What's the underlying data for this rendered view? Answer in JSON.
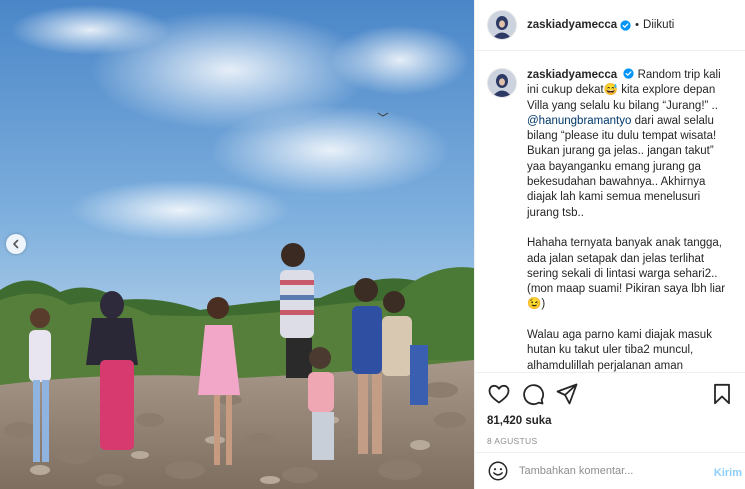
{
  "colors": {
    "verified": "#0095f6",
    "mention": "#00376b",
    "send": "#0095f6",
    "muted": "#8e8e8e"
  },
  "photo": {
    "prev_icon": "chevron-left-icon"
  },
  "header": {
    "username": "zaskiadyamecca",
    "separator": "•",
    "follow_label": "Diikuti",
    "verified_icon": "verified-badge-icon"
  },
  "caption": {
    "username": "zaskiadyamecca",
    "line_1": "Random trip kali ini cukup dekat😅 kita explore depan Villa yang selalu ku bilang “Jurang!” ..",
    "mention": "@hanungbramantyo",
    "line_1b": "dari awal selalu bilang “please itu dulu tempat wisata! Bukan jurang ga jelas.. jangan takut” yaa bayanganku emang jurang ga bekesudahan bawahnya.. Akhirnya diajak lah kami semua menelusuri jurang tsb..",
    "para_2": "Hahaha ternyata banyak anak tangga, ada jalan setapak dan jelas terlihat sering sekali di lintasi warga sehari2.. (mon maap suami! Pikiran saya lbh liar😉)",
    "para_3": "Walau aga parno kami diajak masuk hutan ku takut uler tiba2 muncul, alhamdulillah perjalanan aman"
  },
  "actions": {
    "like_icon": "heart-icon",
    "comment_icon": "comment-icon",
    "share_icon": "share-icon",
    "save_icon": "bookmark-icon",
    "likes": "81,420 suka",
    "date": "8 AGUSTUS"
  },
  "comment_box": {
    "emoji_icon": "smiley-icon",
    "placeholder": "Tambahkan komentar...",
    "send_label": "Kirim"
  }
}
